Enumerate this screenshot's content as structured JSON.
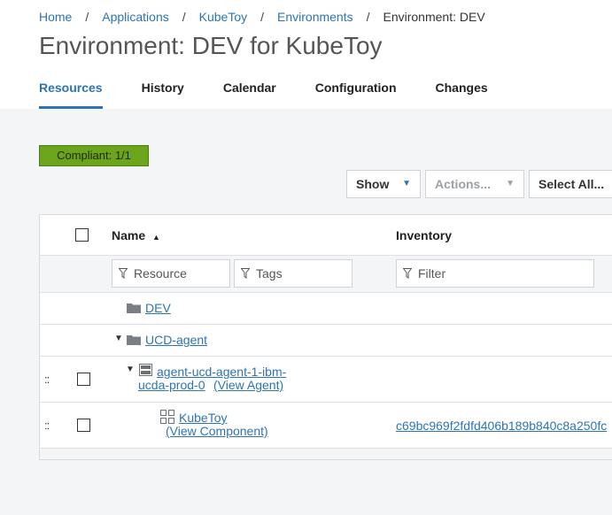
{
  "breadcrumb": {
    "items": [
      "Home",
      "Applications",
      "KubeToy",
      "Environments"
    ],
    "current": "Environment: DEV",
    "separator": "/"
  },
  "page_title": "Environment: DEV for KubeToy",
  "tabs": [
    {
      "label": "Resources",
      "active": true
    },
    {
      "label": "History",
      "active": false
    },
    {
      "label": "Calendar",
      "active": false
    },
    {
      "label": "Configuration",
      "active": false
    },
    {
      "label": "Changes",
      "active": false
    }
  ],
  "compliance": {
    "label": "Compliant: 1/1",
    "color": "#6ca51c"
  },
  "toolbar": {
    "show_label": "Show",
    "actions_label": "Actions...",
    "select_all_label": "Select All..."
  },
  "table": {
    "columns": {
      "name": "Name",
      "inventory": "Inventory",
      "sort_indicator": "▲"
    },
    "filters": {
      "resource": "Resource",
      "tags": "Tags",
      "inventory": "Filter"
    },
    "rows": {
      "dev": {
        "label": "DEV",
        "icon": "folder-icon"
      },
      "ucd_agent": {
        "label": "UCD-agent",
        "icon": "folder-icon",
        "expanded": true
      },
      "agent": {
        "label_line1": "agent-ucd-agent-1-ibm-",
        "label_line2": "ucda-prod-0",
        "view_link": "(View Agent)",
        "icon": "server-icon",
        "expanded": true
      },
      "component": {
        "label": "KubeToy",
        "view_link": "(View Component)",
        "icon": "component-icon",
        "inventory": "c69bc969f2fdfd406b189b840c8a250fc"
      }
    }
  },
  "colors": {
    "accent": "#2d74b5",
    "compliant": "#6ca51c",
    "content_bg": "#f4f5f7"
  }
}
